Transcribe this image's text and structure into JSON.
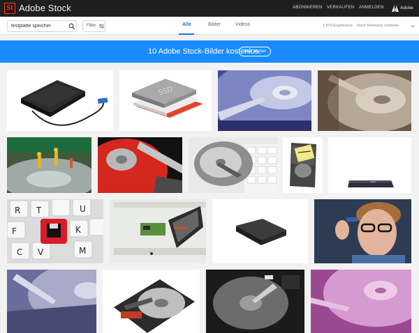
{
  "header": {
    "logo_text": "St",
    "brand": "Adobe Stock",
    "nav": [
      "ABONNIEREN",
      "VERKAUFEN",
      "ANMELDEN"
    ],
    "adobe_label": "Adobe"
  },
  "search": {
    "value": "festplatte speicher",
    "filter_label": "Filter",
    "tabs": [
      "Alle",
      "Bilder",
      "Videos"
    ],
    "active_tab": "Alle",
    "result_count": "1.579 Ergebnisse",
    "sort_label": "Nach Relevanz sortieren"
  },
  "banner": {
    "text": "10 Adobe Stock-Bilder kostenlos.",
    "button": "Jetzt starten"
  },
  "colors": {
    "topbar": "#1f1f1f",
    "accent": "#1473e6",
    "banner": "#1a8cff",
    "logo_orange": "#e04a1f"
  },
  "gallery": [
    {
      "subject": "external-hard-drive-with-usb-cable"
    },
    {
      "subject": "ssd-drives"
    },
    {
      "subject": "hard-disk-platter-closeup-blue"
    },
    {
      "subject": "hard-disk-platter-closeup-sepia"
    },
    {
      "subject": "miniature-workers-on-hard-disk"
    },
    {
      "subject": "red-hard-disk-platter"
    },
    {
      "subject": "hard-disk-on-keyboard"
    },
    {
      "subject": "hard-drive-with-note"
    },
    {
      "subject": "slim-drive-on-white"
    },
    {
      "subject": "keyboard-with-red-floppy-key"
    },
    {
      "subject": "disassembled-hard-drive-parts"
    },
    {
      "subject": "black-external-drive"
    },
    {
      "subject": "man-holding-usb-stick"
    },
    {
      "subject": "hard-disk-closeup-purple-blue"
    },
    {
      "subject": "open-hard-drive-on-white"
    },
    {
      "subject": "open-hard-drive-black"
    },
    {
      "subject": "hard-disk-platter-pink"
    }
  ]
}
